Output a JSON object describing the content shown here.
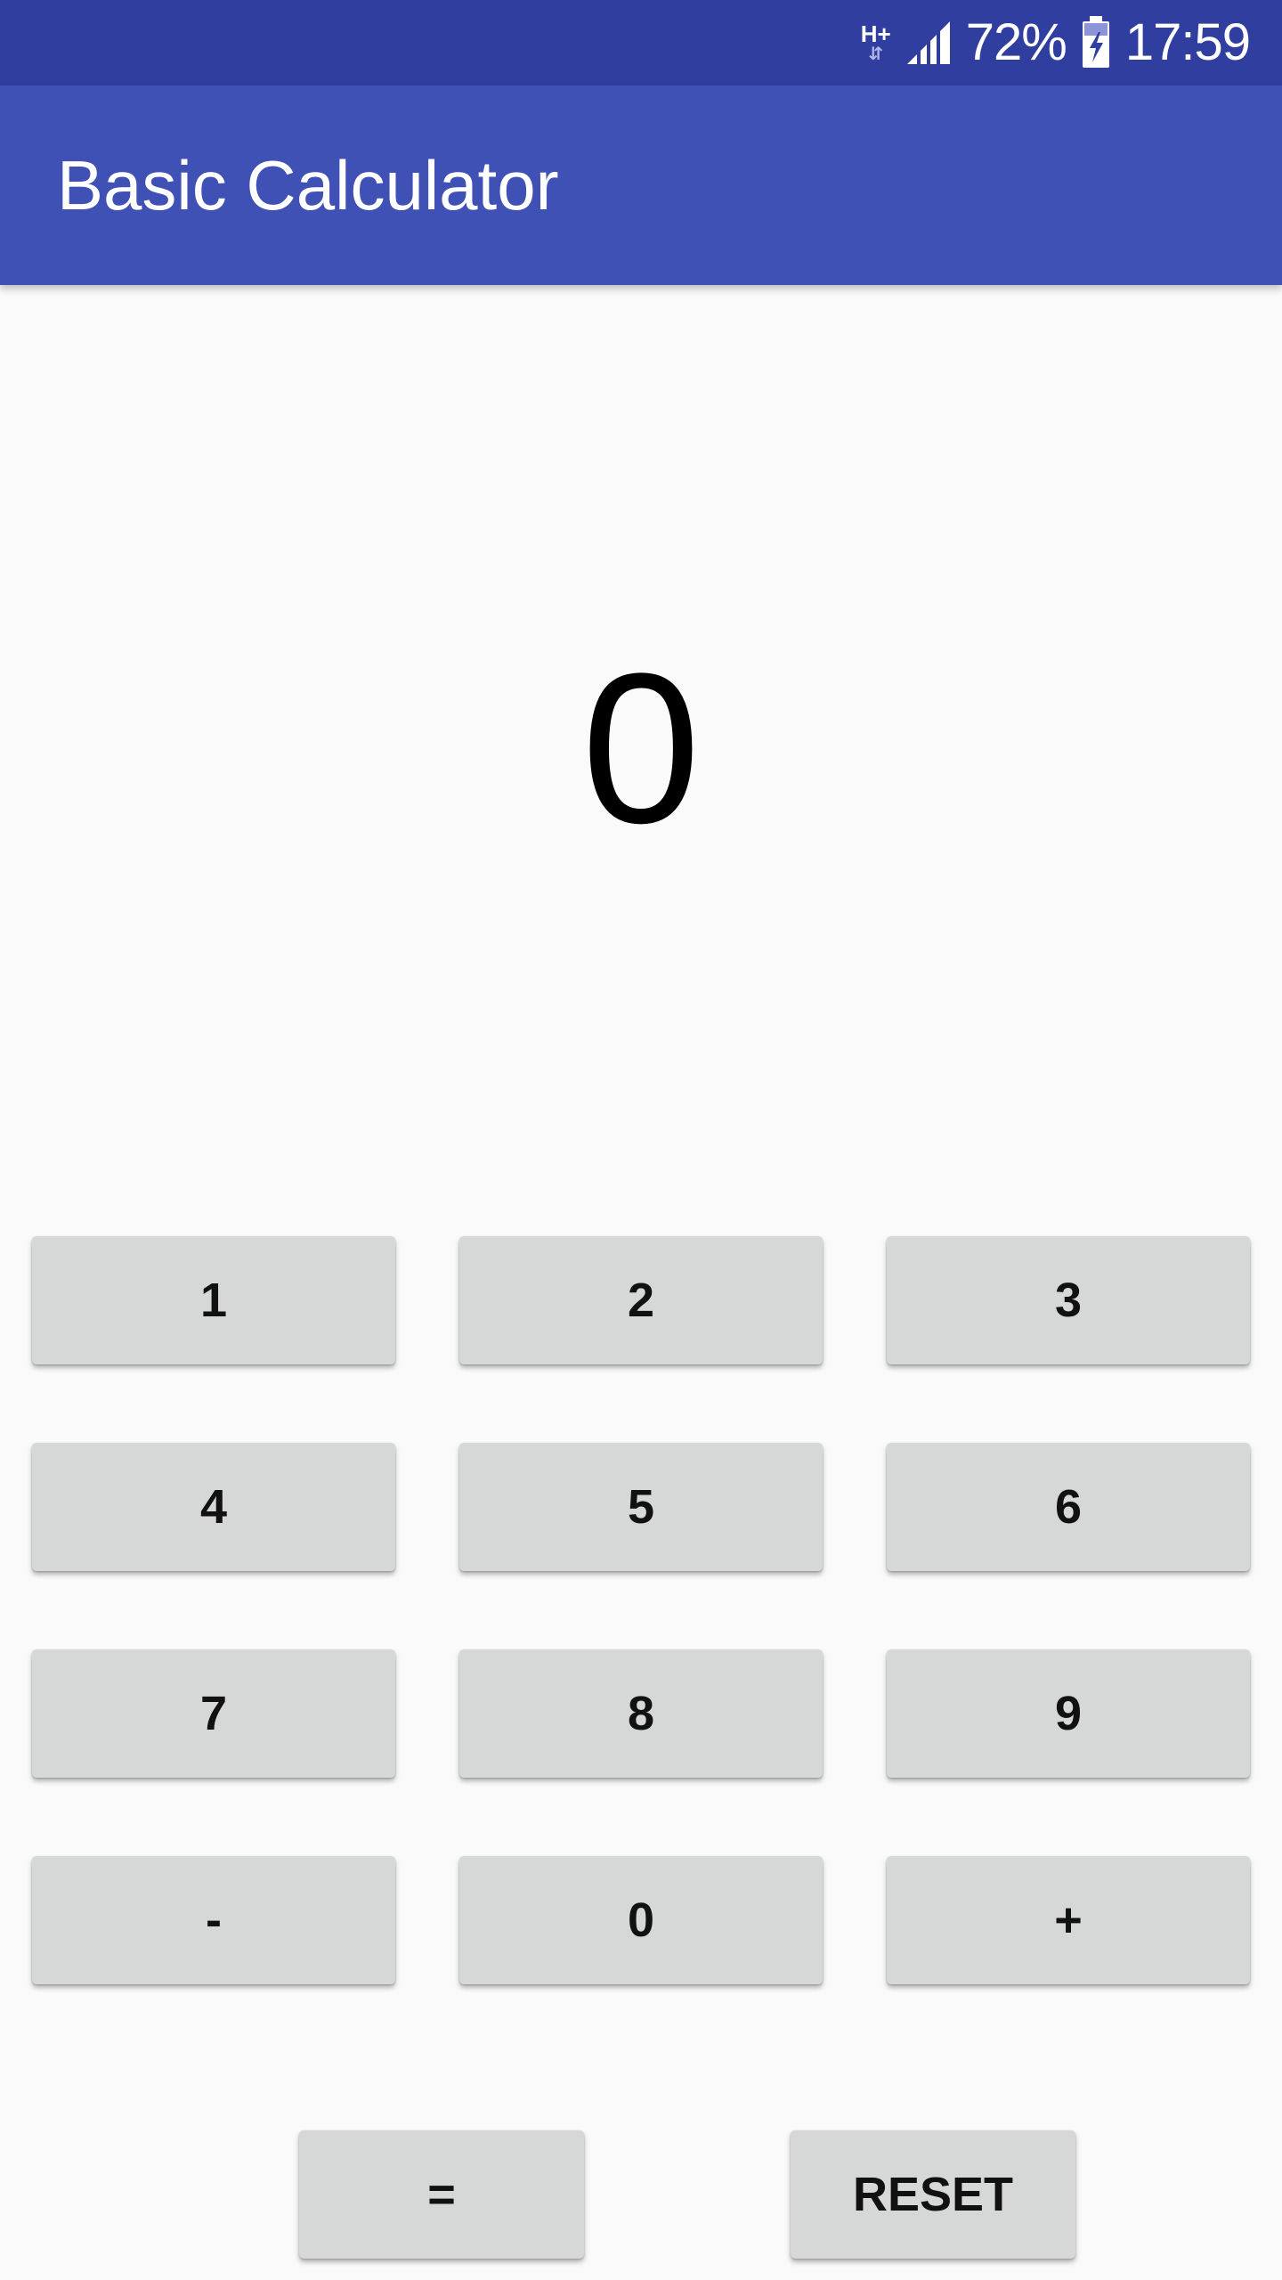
{
  "status_bar": {
    "network_type": "H+",
    "network_arrows": "⇵",
    "battery_percent": "72%",
    "time": "17:59"
  },
  "app_bar": {
    "title": "Basic Calculator"
  },
  "display": {
    "value": "0"
  },
  "keypad": {
    "key_1": "1",
    "key_2": "2",
    "key_3": "3",
    "key_4": "4",
    "key_5": "5",
    "key_6": "6",
    "key_7": "7",
    "key_8": "8",
    "key_9": "9",
    "key_minus": "-",
    "key_0": "0",
    "key_plus": "+",
    "key_equals": "=",
    "key_reset": "RESET"
  },
  "colors": {
    "status_bar": "#303f9f",
    "app_bar": "#3f51b5",
    "background": "#fafafa",
    "button": "#d6d7d7"
  }
}
